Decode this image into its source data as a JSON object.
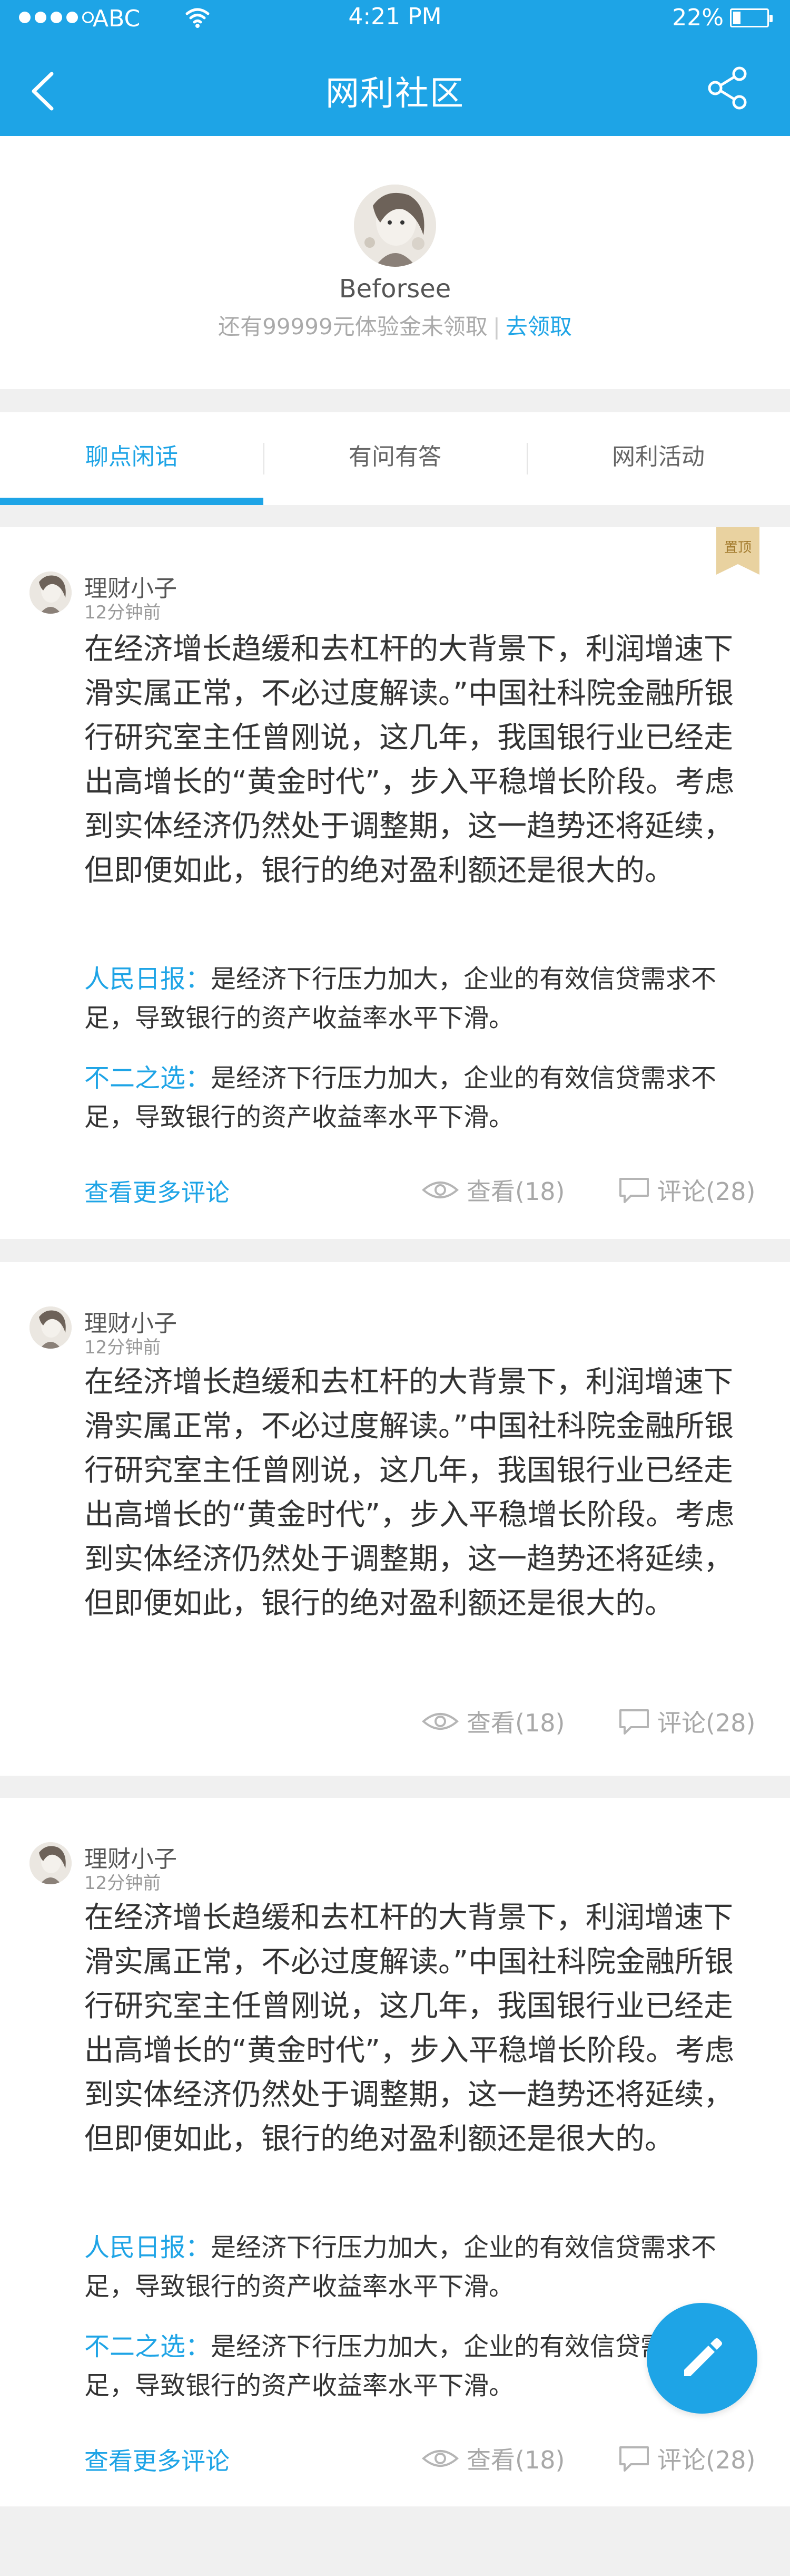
{
  "status_bar": {
    "carrier": "ABC",
    "time": "4:21 PM",
    "battery": "22%",
    "battery_level": 0.22
  },
  "nav": {
    "title": "网利社区",
    "back_icon": "back-arrow-icon",
    "share_icon": "share-icon"
  },
  "profile": {
    "username": "Beforsee",
    "trial_text": "还有99999元体验金未领取",
    "separator": "|",
    "claim_link": "去领取"
  },
  "tabs": [
    {
      "label": "聊点闲话",
      "active": true
    },
    {
      "label": "有问有答",
      "active": false
    },
    {
      "label": "网利活动",
      "active": false
    }
  ],
  "posts": [
    {
      "pinned": true,
      "pin_label": "置顶",
      "author": "理财小子",
      "time": "12分钟前",
      "body": "在经济增长趋缓和去杠杆的大背景下，利润增速下滑实属正常，不必过度解读。”中国社科院金融所银行研究室主任曾刚说，这几年，我国银行业已经走出高增长的“黄金时代”，步入平稳增长阶段。考虑到实体经济仍然处于调整期，这一趋势还将延续，但即便如此，银行的绝对盈利额还是很大的。",
      "comments": [
        {
          "who": "人民日报：",
          "text": "是经济下行压力加大，企业的有效信贷需求不足，导致银行的资产收益率水平下滑。"
        },
        {
          "who": "不二之选：",
          "text": "是经济下行压力加大，企业的有效信贷需求不足，导致银行的资产收益率水平下滑。"
        }
      ],
      "more_comments": "查看更多评论",
      "views": "查看(18)",
      "replies": "评论(28)"
    },
    {
      "pinned": false,
      "author": "理财小子",
      "time": "12分钟前",
      "body": "在经济增长趋缓和去杠杆的大背景下，利润增速下滑实属正常，不必过度解读。”中国社科院金融所银行研究室主任曾刚说，这几年，我国银行业已经走出高增长的“黄金时代”，步入平稳增长阶段。考虑到实体经济仍然处于调整期，这一趋势还将延续，但即便如此，银行的绝对盈利额还是很大的。",
      "views": "查看(18)",
      "replies": "评论(28)"
    },
    {
      "pinned": false,
      "author": "理财小子",
      "time": "12分钟前",
      "body": "在经济增长趋缓和去杠杆的大背景下，利润增速下滑实属正常，不必过度解读。”中国社科院金融所银行研究室主任曾刚说，这几年，我国银行业已经走出高增长的“黄金时代”，步入平稳增长阶段。考虑到实体经济仍然处于调整期，这一趋势还将延续，但即便如此，银行的绝对盈利额还是很大的。",
      "comments": [
        {
          "who": "人民日报：",
          "text": "是经济下行压力加大，企业的有效信贷需求不足，导致银行的资产收益率水平下滑。"
        },
        {
          "who": "不二之选：",
          "text": "是经济下行压力加大，企业的有效信贷需求不足，导致银行的资产收益率水平下滑。"
        }
      ],
      "more_comments": "查看更多评论",
      "views": "查看(18)",
      "replies": "评论(28)"
    }
  ],
  "fab": {
    "icon": "edit-pencil-icon"
  },
  "colors": {
    "accent": "#1ea4e6",
    "pin_badge": "#e9d2a0"
  }
}
